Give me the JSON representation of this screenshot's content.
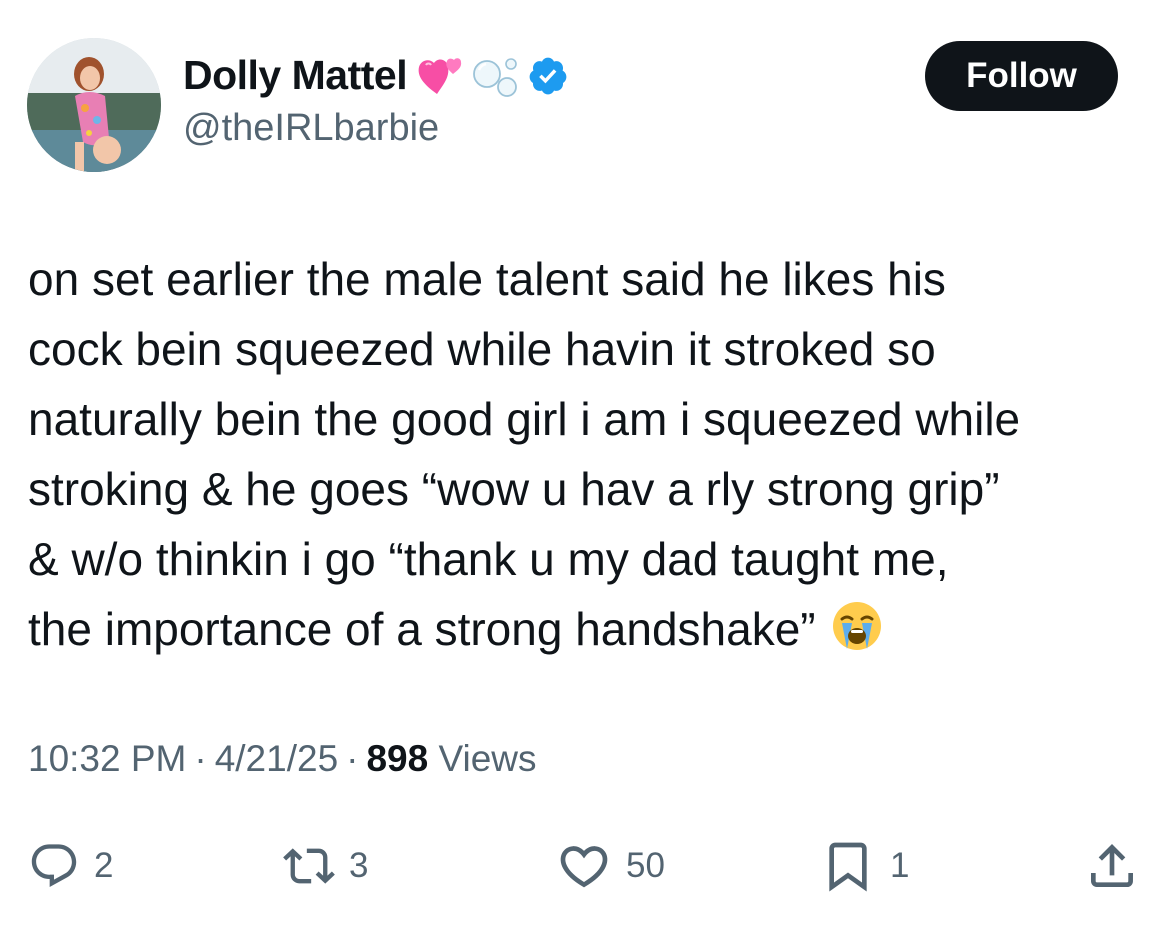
{
  "author": {
    "display_name": "Dolly Mattel",
    "handle": "@theIRLbarbie",
    "name_emoji": [
      "heart-emoji",
      "bubbles-emoji"
    ],
    "verified": true
  },
  "follow_button": {
    "label": "Follow"
  },
  "tweet": {
    "lines": [
      "on set earlier the male talent said he likes his",
      "cock bein squeezed while havin it stroked so",
      "naturally bein the good girl i am i squeezed while",
      "stroking & he goes “wow u hav a rly strong grip”",
      "& w/o thinkin i go “thank u my dad taught me,",
      "the importance of a strong handshake”"
    ],
    "trailing_emoji": "loudly-crying-face-emoji"
  },
  "meta": {
    "time": "10:32 PM",
    "separator": "·",
    "date": "4/21/25",
    "views_count": "898",
    "views_label": "Views"
  },
  "actions": {
    "replies": "2",
    "reposts": "3",
    "likes": "50",
    "bookmarks": "1"
  },
  "colors": {
    "text": "#0f1419",
    "secondary": "#536471",
    "verified": "#1d9bf0",
    "follow_bg": "#0f1419"
  }
}
